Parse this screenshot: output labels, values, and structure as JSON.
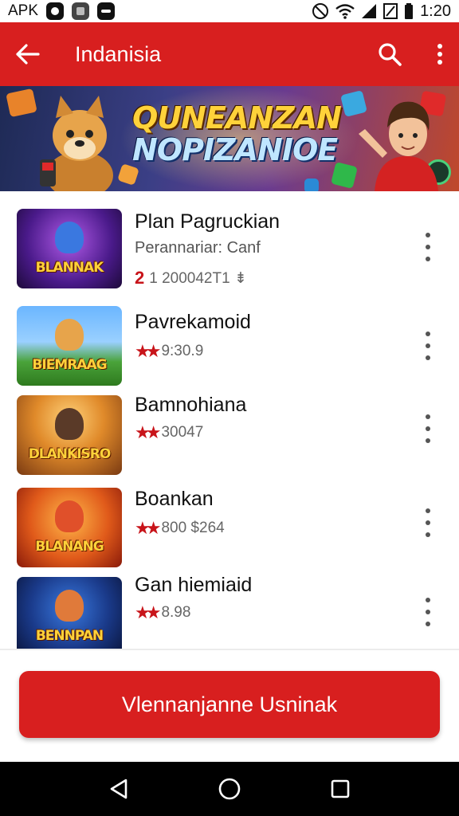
{
  "status_bar": {
    "left_text": "APK",
    "time": "1:20"
  },
  "app_bar": {
    "title": "Indanisia",
    "back_icon": "arrow-left-icon",
    "search_icon": "search-icon",
    "menu_icon": "more-vert-icon"
  },
  "banner": {
    "line1": "QUNEANZAN",
    "line2": "NOPIZANIOE"
  },
  "games": [
    {
      "name": "Plan Pagruckian",
      "subtitle": "Perannariar: Canf",
      "rating": "2",
      "meta": "1 200042T1 ⇟",
      "thumb_text": "BLANNAK"
    },
    {
      "name": "Pavrekamoid",
      "meta": "9:30.9",
      "thumb_text": "BIEMRAAG"
    },
    {
      "name": "Bamnohiana",
      "meta": "30047",
      "thumb_text": "DLANKISRO"
    },
    {
      "name": "Boankan",
      "meta": "800 $264",
      "thumb_text": "BLANANG"
    },
    {
      "name": "Gan hiemiaid",
      "meta": "8.98",
      "thumb_text": "BENNPAN"
    }
  ],
  "cta_label": "Vlennanjanne Usninak",
  "colors": {
    "primary": "#d81f1f",
    "star": "#c8141a"
  }
}
